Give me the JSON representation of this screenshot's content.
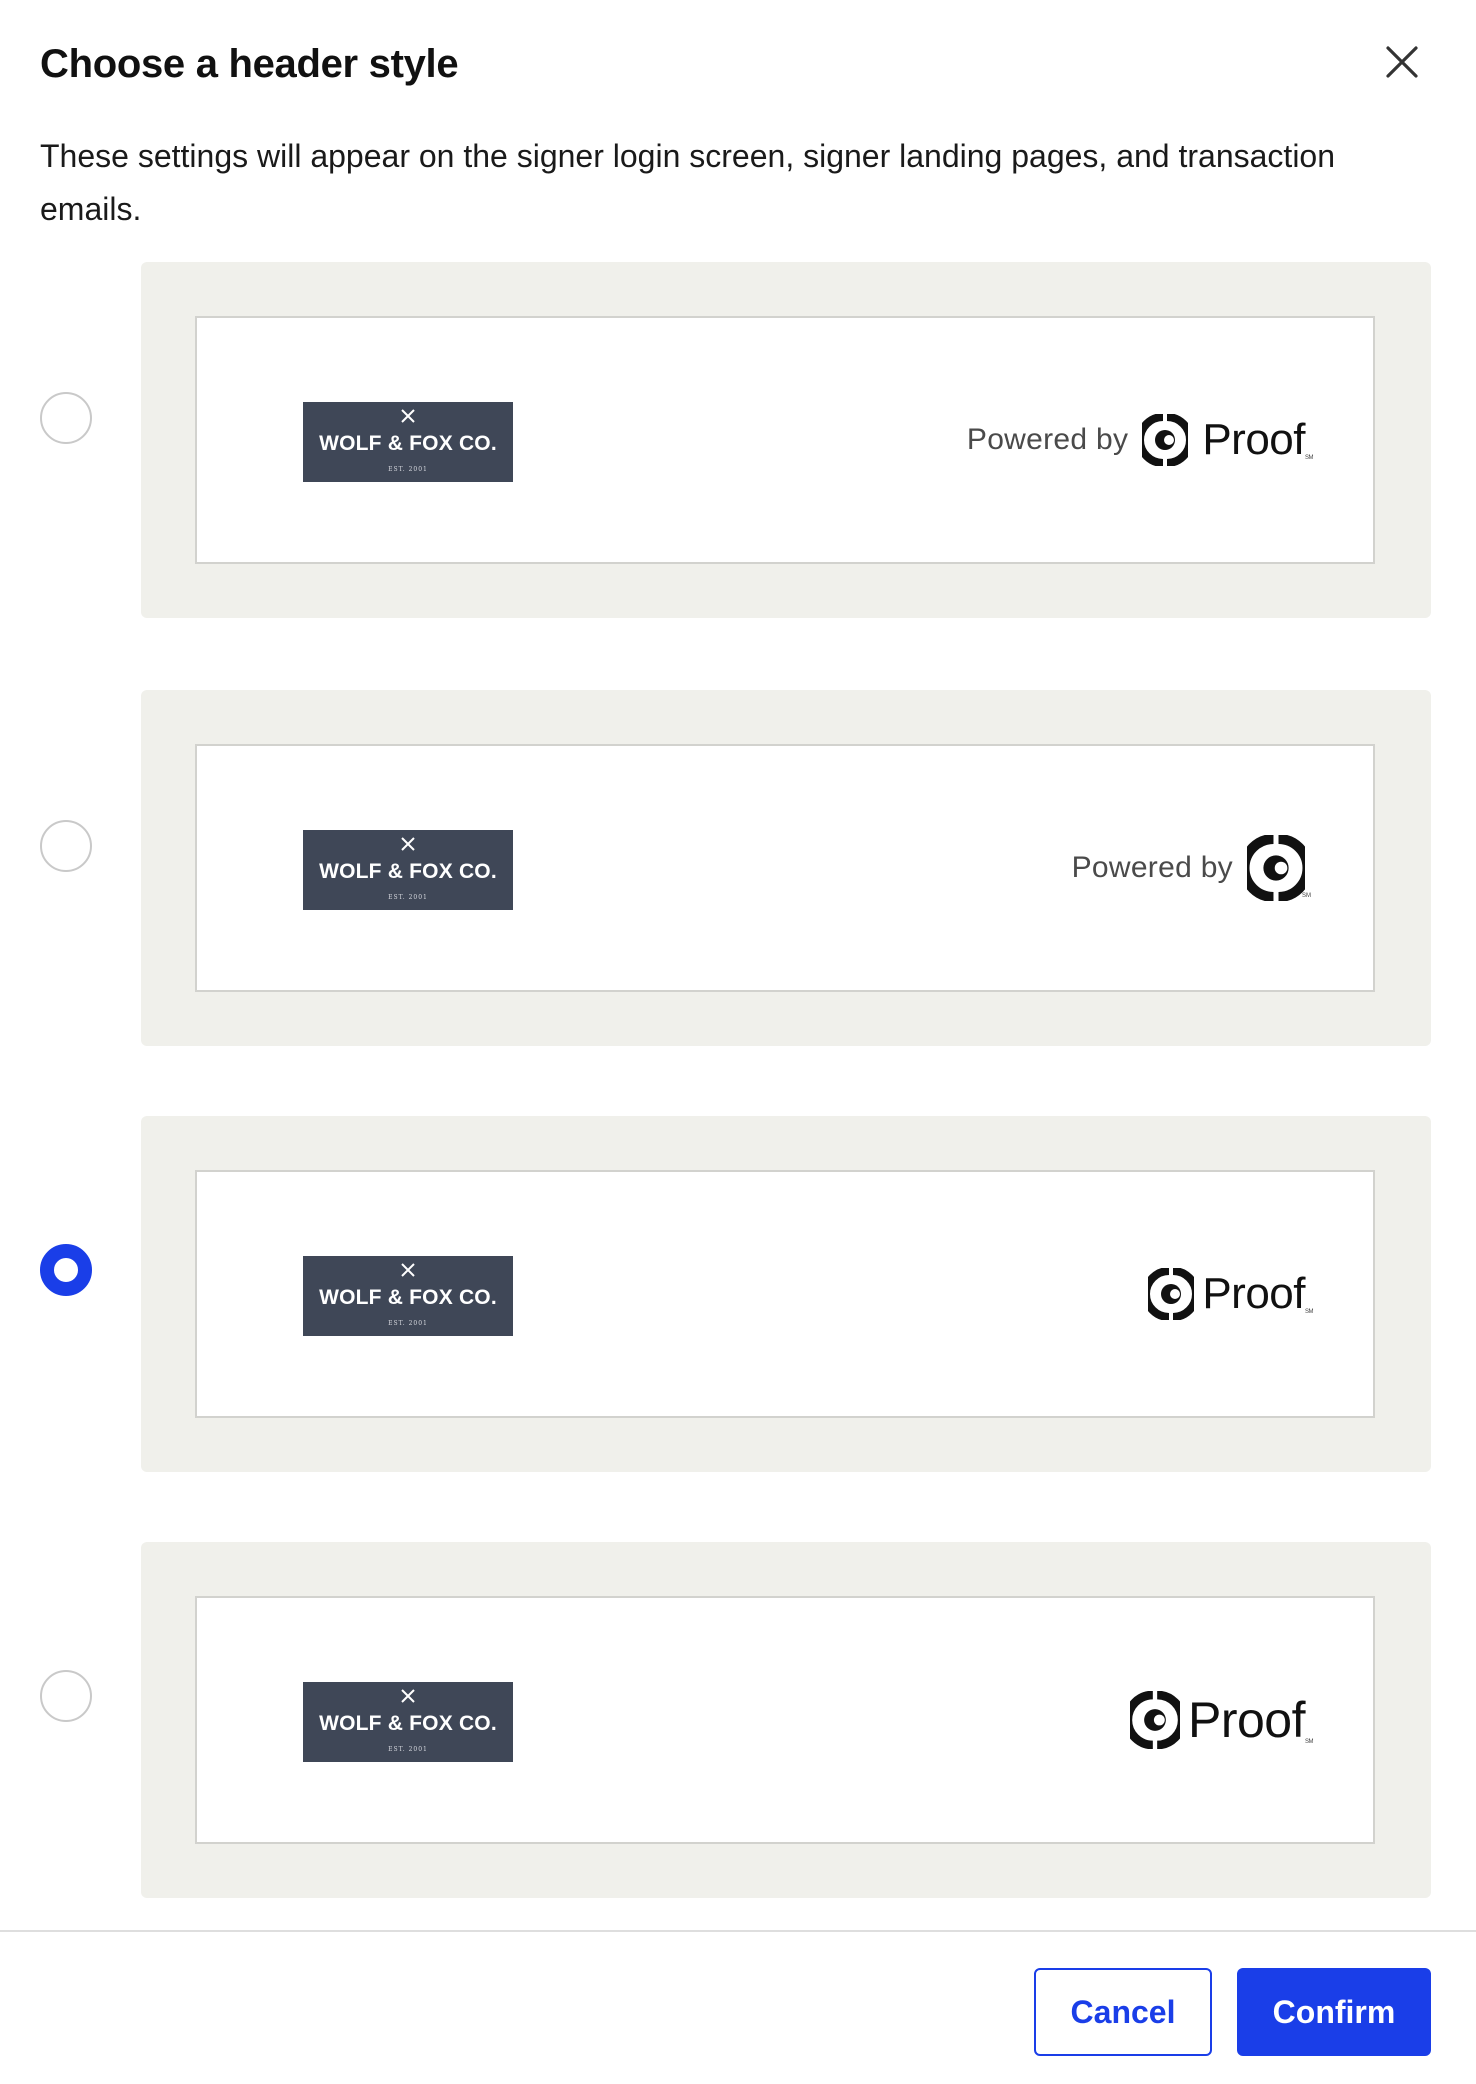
{
  "dialog": {
    "title": "Choose a header style",
    "description": "These settings will appear on the signer login screen, signer landing pages, and transaction emails.",
    "close_icon": "close-icon"
  },
  "options": [
    {
      "selected": false,
      "company_logo": {
        "name": "WOLF & FOX CO.",
        "tagline": "EST. 2001"
      },
      "powered_by": "Powered by",
      "proof_text": "Proof",
      "sm": "SM"
    },
    {
      "selected": false,
      "company_logo": {
        "name": "WOLF & FOX CO.",
        "tagline": "EST. 2001"
      },
      "powered_by": "Powered by",
      "proof_text": "",
      "sm": "SM"
    },
    {
      "selected": true,
      "company_logo": {
        "name": "WOLF & FOX CO.",
        "tagline": "EST. 2001"
      },
      "powered_by": "",
      "proof_text": "Proof",
      "sm": "SM"
    },
    {
      "selected": false,
      "company_logo": {
        "name": "WOLF & FOX CO.",
        "tagline": "EST. 2001"
      },
      "powered_by": "",
      "proof_text": "Proof",
      "sm": "SM"
    }
  ],
  "footer": {
    "cancel_label": "Cancel",
    "confirm_label": "Confirm"
  },
  "colors": {
    "accent": "#1a3ee8",
    "card_bg": "#f0f0eb",
    "logo_bg": "#3f4757"
  }
}
